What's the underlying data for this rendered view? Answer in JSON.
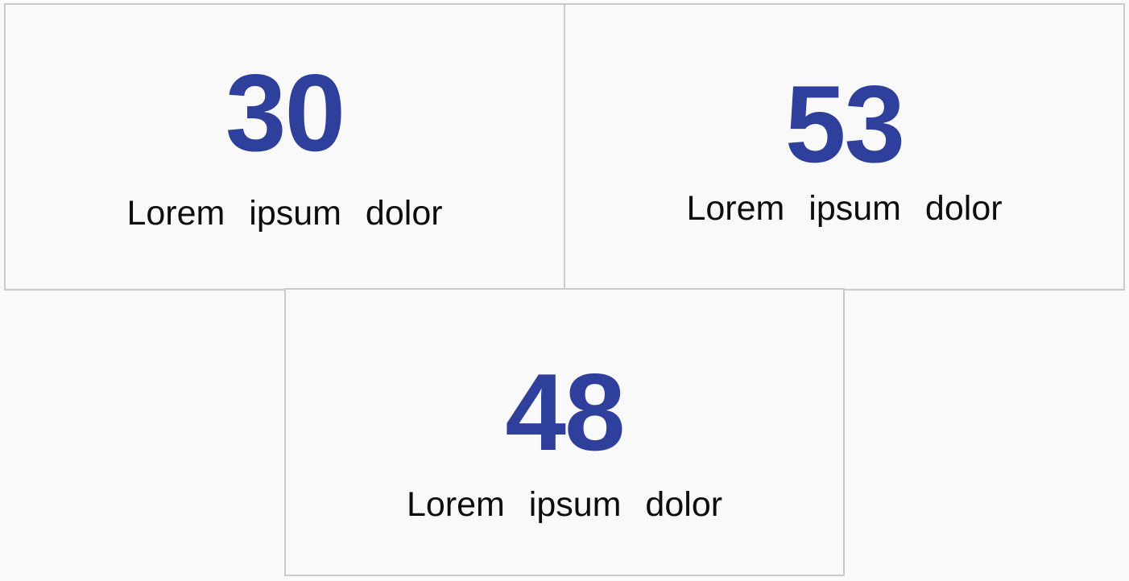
{
  "colors": {
    "value": "#2e3f9c",
    "label": "#0d0d0d",
    "border": "#cacaca",
    "background": "#f9f9fa"
  },
  "stats": [
    {
      "value": "30",
      "label": "Lorem ipsum dolor"
    },
    {
      "value": "53",
      "label": "Lorem ipsum dolor"
    },
    {
      "value": "48",
      "label": "Lorem ipsum dolor"
    }
  ]
}
